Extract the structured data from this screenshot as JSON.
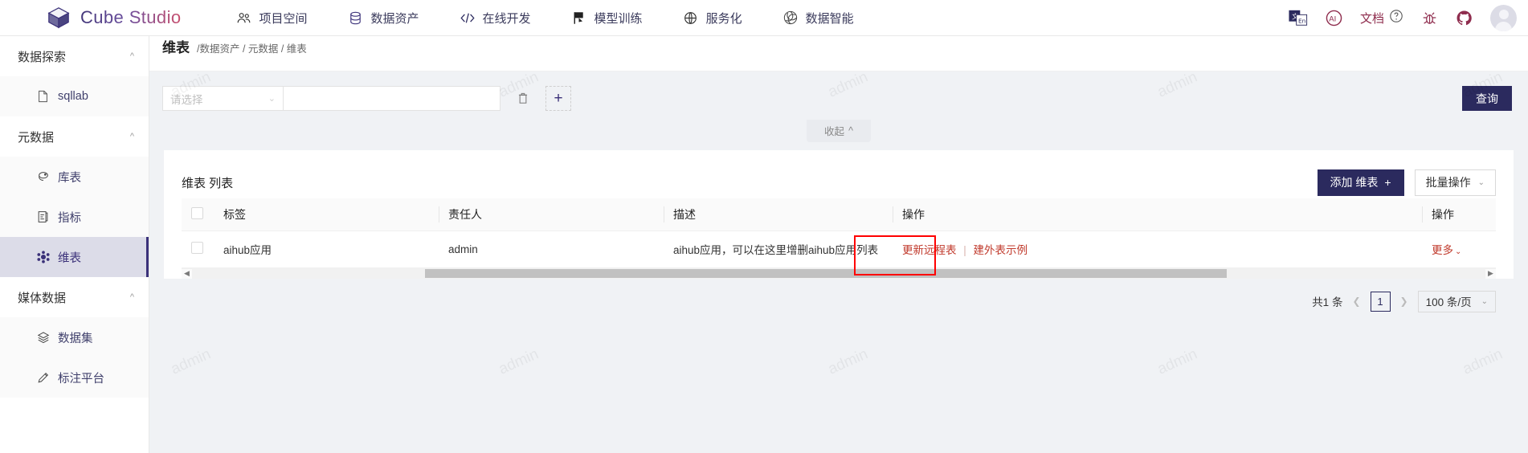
{
  "brand": {
    "title": "Cube Studio",
    "logo_icon": "cube-icon"
  },
  "topnav": [
    {
      "label": "项目空间",
      "icon": "team-icon"
    },
    {
      "label": "数据资产",
      "icon": "database-icon"
    },
    {
      "label": "在线开发",
      "icon": "code-icon"
    },
    {
      "label": "模型训练",
      "icon": "flag-icon"
    },
    {
      "label": "服务化",
      "icon": "globe-icon"
    },
    {
      "label": "数据智能",
      "icon": "ai-spiral-icon"
    }
  ],
  "topbar_right": {
    "translate_icon": "translate-icon",
    "ai_icon": "ai-circle-icon",
    "doc_label": "文档",
    "help_icon": "question-circle-icon",
    "bug_icon": "bug-icon",
    "github_icon": "github-icon",
    "avatar_icon": "user-avatar"
  },
  "sidebar": {
    "groups": [
      {
        "label": "数据探索",
        "caret": "chevron-up-icon",
        "items": [
          {
            "label": "sqllab",
            "icon": "file-sql-icon",
            "active": false
          }
        ]
      },
      {
        "label": "元数据",
        "caret": "chevron-up-icon",
        "items": [
          {
            "label": "库表",
            "icon": "hive-icon",
            "active": false
          },
          {
            "label": "指标",
            "icon": "metric-icon",
            "active": false
          },
          {
            "label": "维表",
            "icon": "cube-small-icon",
            "active": true
          }
        ]
      },
      {
        "label": "媒体数据",
        "caret": "chevron-up-icon",
        "items": [
          {
            "label": "数据集",
            "icon": "dataset-icon",
            "active": false
          },
          {
            "label": "标注平台",
            "icon": "pencil-icon",
            "active": false
          }
        ]
      }
    ]
  },
  "breadcrumb": {
    "title": "维表",
    "path": "/数据资产 / 元数据 / 维表"
  },
  "filter": {
    "select_placeholder": "请选择",
    "select_chevron": "chevron-down-icon",
    "input_value": "",
    "input_placeholder": "",
    "delete_icon": "trash-icon",
    "add_icon": "plus-icon",
    "query_label": "查询",
    "collapse_label": "收起",
    "collapse_icon": "chevron-up-icon"
  },
  "table_card": {
    "title": "维表 列表",
    "add_label": "添加 维表",
    "add_icon": "plus-icon",
    "batch_label": "批量操作",
    "batch_chevron": "chevron-down-icon",
    "columns": [
      "标签",
      "责任人",
      "描述",
      "操作",
      "操作"
    ],
    "rows": [
      {
        "checked": false,
        "标签": "aihub应用",
        "责任人": "admin",
        "描述": "aihub应用，可以在这里增删aihub应用列表",
        "actions": [
          "更新远程表",
          "建外表示例"
        ],
        "more_label": "更多",
        "more_chevron": "chevron-down-icon"
      }
    ]
  },
  "pagination": {
    "total_text": "共1 条",
    "prev_icon": "chevron-left-icon",
    "page": "1",
    "next_icon": "chevron-right-icon",
    "page_size": "100 条/页",
    "page_size_chevron": "chevron-down-icon"
  },
  "watermark_text": "admin",
  "highlight": {
    "color": "#ff0000"
  }
}
